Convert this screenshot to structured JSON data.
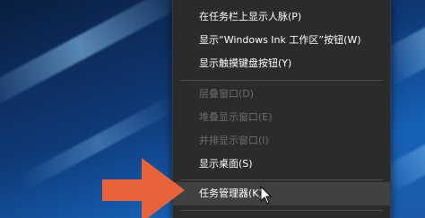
{
  "menu": {
    "items": [
      {
        "label": "在任务栏上显示人脉(P)",
        "enabled": true
      },
      {
        "label": "显示“Windows Ink 工作区”按钮(W)",
        "enabled": true
      },
      {
        "label": "显示触摸键盘按钮(Y)",
        "enabled": true
      },
      {
        "label": "层叠窗口(D)",
        "enabled": false
      },
      {
        "label": "堆叠显示窗口(E)",
        "enabled": false
      },
      {
        "label": "并排显示窗口(I)",
        "enabled": false
      },
      {
        "label": "显示桌面(S)",
        "enabled": true
      },
      {
        "label": "任务管理器(K)",
        "enabled": true,
        "highlighted": true
      }
    ]
  },
  "colors": {
    "menu_background": "#2b2b2b",
    "menu_text": "#ffffff",
    "menu_text_disabled": "#6d6d6d",
    "menu_hover": "#414141",
    "arrow": "#e8623a"
  },
  "icons": {
    "pointer": "arrow-cursor-icon",
    "annotation": "arrow-right-icon"
  }
}
